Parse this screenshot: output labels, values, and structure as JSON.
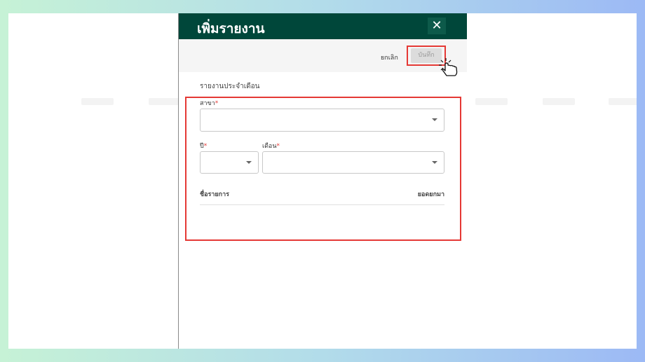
{
  "dialog": {
    "title": "เพิ่มรายงาน",
    "close_symbol": "✕"
  },
  "toolbar": {
    "cancel_label": "ยกเลิก",
    "save_label": "บันทึก"
  },
  "form": {
    "subtitle": "รายงานประจำเดือน",
    "branch_label": "สาขา",
    "year_label": "ปี",
    "month_label": "เดือน",
    "required_mark": "*",
    "branch_value": "",
    "year_value": "",
    "month_value": ""
  },
  "table": {
    "col_name": "ชื่อรายการ",
    "col_balance": "ยอดยกมา"
  },
  "colors": {
    "header": "#00473a",
    "highlight": "#e53935",
    "required": "#e53935"
  }
}
